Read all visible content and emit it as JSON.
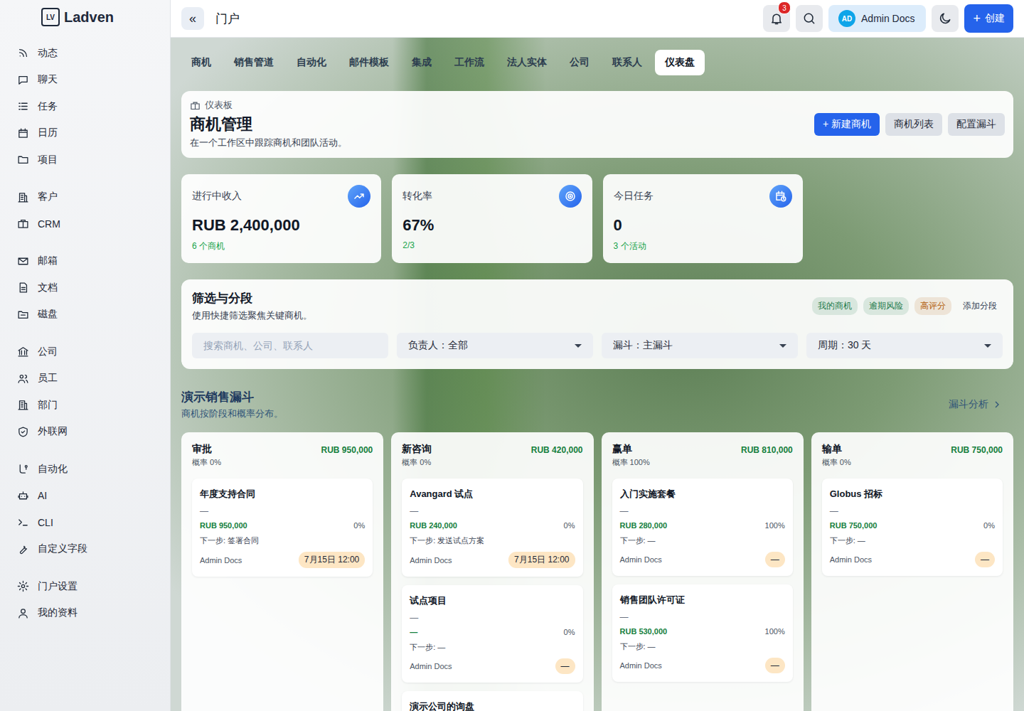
{
  "sidebar": {
    "logo": {
      "mark": "LV",
      "name": "Ladven"
    },
    "groups": [
      {
        "items": [
          {
            "label": "动态",
            "selected": false
          },
          {
            "label": "聊天",
            "selected": false
          },
          {
            "label": "任务",
            "selected": false
          },
          {
            "label": "日历",
            "selected": false
          },
          {
            "label": "项目",
            "selected": false
          }
        ]
      },
      {
        "items": [
          {
            "label": "客户",
            "selected": false
          },
          {
            "label": "CRM",
            "selected": false
          }
        ]
      },
      {
        "items": [
          {
            "label": "邮箱",
            "selected": false
          },
          {
            "label": "文档",
            "selected": false
          },
          {
            "label": "磁盘",
            "selected": false
          }
        ]
      },
      {
        "items": [
          {
            "label": "公司",
            "selected": false
          },
          {
            "label": "员工",
            "selected": false
          },
          {
            "label": "部门",
            "selected": false
          },
          {
            "label": "外联网",
            "selected": false
          }
        ]
      },
      {
        "items": [
          {
            "label": "自动化",
            "selected": false
          },
          {
            "label": "AI",
            "selected": false
          },
          {
            "label": "CLI",
            "selected": false
          },
          {
            "label": "自定义字段",
            "selected": false
          }
        ]
      },
      {
        "items": [
          {
            "label": "门户设置",
            "selected": false
          },
          {
            "label": "我的资料",
            "selected": false
          }
        ]
      }
    ]
  },
  "topbar": {
    "collapse": "«",
    "title": "门户",
    "notifications": "3",
    "user": {
      "initials": "AD",
      "name": "Admin Docs"
    },
    "create": {
      "icon": "+",
      "label": "创建"
    }
  },
  "tabs": [
    {
      "label": "商机",
      "selected": false
    },
    {
      "label": "销售管道",
      "selected": false
    },
    {
      "label": "自动化",
      "selected": false
    },
    {
      "label": "邮件模板",
      "selected": false
    },
    {
      "label": "集成",
      "selected": false
    },
    {
      "label": "工作流",
      "selected": false
    },
    {
      "label": "法人实体",
      "selected": false
    },
    {
      "label": "公司",
      "selected": false
    },
    {
      "label": "联系人",
      "selected": false
    },
    {
      "label": "仪表盘",
      "selected": true
    }
  ],
  "header": {
    "eyebrow": "仪表板",
    "title": "商机管理",
    "subtitle": "在一个工作区中跟踪商机和团队活动。",
    "buttons": [
      {
        "label": "+ 新建商机",
        "primary": true
      },
      {
        "label": "商机列表",
        "primary": false
      },
      {
        "label": "配置漏斗",
        "primary": false
      }
    ]
  },
  "kpis": [
    {
      "label": "进行中收入",
      "value": "RUB 2,400,000",
      "sub": "6 个商机"
    },
    {
      "label": "转化率",
      "value": "67%",
      "sub": "2/3"
    },
    {
      "label": "今日任务",
      "value": "0",
      "sub": "3 个活动"
    }
  ],
  "filters": {
    "title": "筛选与分段",
    "subtitle": "使用快捷筛选聚焦关键商机。",
    "segments": [
      {
        "label": "我的商机",
        "kind": "segment",
        "color": "#1c7a4b"
      },
      {
        "label": "逾期风险",
        "kind": "segment",
        "color": "#1c7a4b"
      },
      {
        "label": "高评分",
        "kind": "segment",
        "color": "#b4620f"
      },
      {
        "label": "添加分段",
        "kind": "add",
        "color": "#334155"
      }
    ],
    "search": {
      "placeholder": "搜索商机、公司、联系人"
    },
    "selects": [
      {
        "label": "负责人：",
        "value": "全部"
      },
      {
        "label": "漏斗：",
        "value": "主漏斗"
      },
      {
        "label": "周期：",
        "value": "30 天"
      }
    ]
  },
  "funnel": {
    "title": "演示销售漏斗",
    "subtitle": "商机按阶段和概率分布。",
    "link": "漏斗分析",
    "columns": [
      {
        "name": "审批",
        "probability": "概率 0%",
        "total": "RUB 950,000",
        "cards": [
          {
            "title": "年度支持合同",
            "subtitle": "—",
            "amount": "RUB 950,000",
            "prob": "0%",
            "next": "下一步: 签署合同",
            "owner": "Admin Docs",
            "due": "7月15日 12:00"
          }
        ]
      },
      {
        "name": "新咨询",
        "probability": "概率 0%",
        "total": "RUB 420,000",
        "cards": [
          {
            "title": "Avangard 试点",
            "subtitle": "—",
            "amount": "RUB 240,000",
            "prob": "0%",
            "next": "下一步: 发送试点方案",
            "owner": "Admin Docs",
            "due": "7月15日 12:00"
          },
          {
            "title": "试点项目",
            "subtitle": "—",
            "amount": "—",
            "prob": "0%",
            "next": "下一步: —",
            "owner": "Admin Docs",
            "due": "—"
          },
          {
            "title": "演示公司的询盘"
          }
        ]
      },
      {
        "name": "赢单",
        "probability": "概率 100%",
        "total": "RUB 810,000",
        "cards": [
          {
            "title": "入门实施套餐",
            "subtitle": "—",
            "amount": "RUB 280,000",
            "prob": "100%",
            "next": "下一步: —",
            "owner": "Admin Docs",
            "due": "—"
          },
          {
            "title": "销售团队许可证",
            "subtitle": "—",
            "amount": "RUB 530,000",
            "prob": "100%",
            "next": "下一步: —",
            "owner": "Admin Docs",
            "due": "—"
          }
        ]
      },
      {
        "name": "输单",
        "probability": "概率 0%",
        "total": "RUB 750,000",
        "cards": [
          {
            "title": "Globus 招标",
            "subtitle": "—",
            "amount": "RUB 750,000",
            "prob": "0%",
            "next": "下一步: —",
            "owner": "Admin Docs",
            "due": "—"
          }
        ]
      }
    ]
  }
}
